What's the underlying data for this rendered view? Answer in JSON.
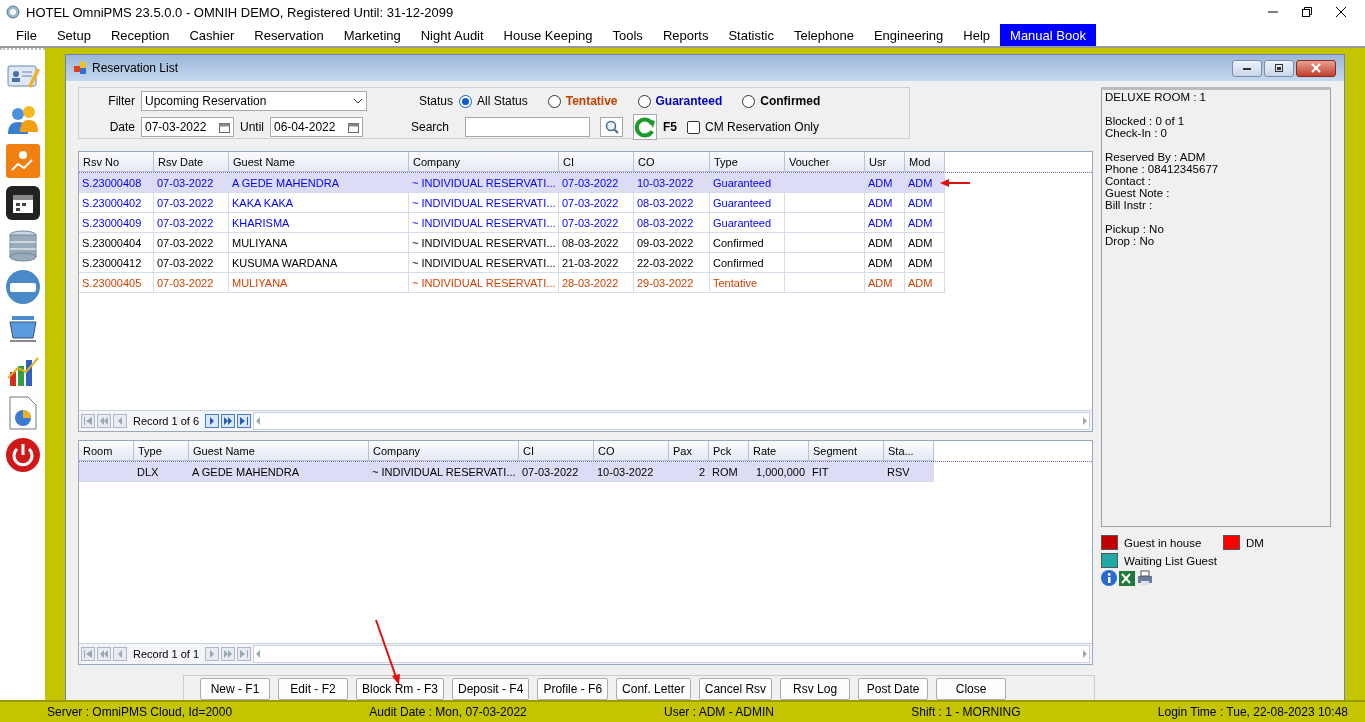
{
  "window": {
    "title": "HOTEL OmniPMS 23.5.0.0 - OMNIH DEMO, Registered Until: 31-12-2099"
  },
  "menu": [
    {
      "label": "File",
      "selected": false
    },
    {
      "label": "Setup",
      "selected": false
    },
    {
      "label": "Reception",
      "selected": false
    },
    {
      "label": "Cashier",
      "selected": false
    },
    {
      "label": "Reservation",
      "selected": false
    },
    {
      "label": "Marketing",
      "selected": false
    },
    {
      "label": "Night Audit",
      "selected": false
    },
    {
      "label": "House Keeping",
      "selected": false
    },
    {
      "label": "Tools",
      "selected": false
    },
    {
      "label": "Reports",
      "selected": false
    },
    {
      "label": "Statistic",
      "selected": false
    },
    {
      "label": "Telephone",
      "selected": false
    },
    {
      "label": "Engineering",
      "selected": false
    },
    {
      "label": "Help",
      "selected": false
    },
    {
      "label": "Manual Book",
      "selected": true
    }
  ],
  "child_window": {
    "title": "Reservation List"
  },
  "filter": {
    "label": "Filter",
    "value": "Upcoming Reservation"
  },
  "date": {
    "label": "Date",
    "value": "07-03-2022"
  },
  "until": {
    "label": "Until",
    "value": "06-04-2022"
  },
  "status": {
    "label": "Status",
    "options": [
      {
        "label": "All Status",
        "kind": "plain",
        "selected": true,
        "color": "#000000"
      },
      {
        "label": "Tentative",
        "kind": "status",
        "selected": false,
        "color": "#c04000"
      },
      {
        "label": "Guaranteed",
        "kind": "status",
        "selected": false,
        "color": "#0000c0"
      },
      {
        "label": "Confirmed",
        "kind": "status",
        "selected": false,
        "color": "#000000"
      }
    ]
  },
  "search": {
    "label": "Search"
  },
  "refresh": {
    "label": "F5"
  },
  "cm_only": {
    "label": "CM Reservation Only",
    "checked": false
  },
  "reservations": {
    "columns": [
      "Rsv No",
      "Rsv Date",
      "Guest Name",
      "Company",
      "CI",
      "CO",
      "Type",
      "Voucher",
      "Usr",
      "Mod"
    ],
    "rows": [
      {
        "cells": [
          "S.23000408",
          "07-03-2022",
          "A GEDE MAHENDRA",
          "~ INDIVIDUAL RESERVATI...",
          "07-03-2022",
          "10-03-2022",
          "Guaranteed",
          null,
          "ADM",
          "ADM"
        ],
        "color": "#0000ff",
        "selected": true
      },
      {
        "cells": [
          "S.23000402",
          "07-03-2022",
          "KAKA KAKA",
          "~ INDIVIDUAL RESERVATI...",
          "07-03-2022",
          "08-03-2022",
          "Guaranteed",
          null,
          "ADM",
          "ADM"
        ],
        "color": "#0000ff",
        "selected": false
      },
      {
        "cells": [
          "S.23000409",
          "07-03-2022",
          "KHARISMA",
          "~ INDIVIDUAL RESERVATI...",
          "07-03-2022",
          "08-03-2022",
          "Guaranteed",
          null,
          "ADM",
          "ADM"
        ],
        "color": "#0000ff",
        "selected": false
      },
      {
        "cells": [
          "S.23000404",
          "07-03-2022",
          "MULIYANA",
          "~ INDIVIDUAL RESERVATI...",
          "08-03-2022",
          "09-03-2022",
          "Confirmed",
          null,
          "ADM",
          "ADM"
        ],
        "color": "#000000",
        "selected": false
      },
      {
        "cells": [
          "S.23000412",
          "07-03-2022",
          "KUSUMA WARDANA",
          "~ INDIVIDUAL RESERVATI...",
          "21-03-2022",
          "22-03-2022",
          "Confirmed",
          null,
          "ADM",
          "ADM"
        ],
        "color": "#000000",
        "selected": false
      },
      {
        "cells": [
          "S.23000405",
          "07-03-2022",
          "MULIYANA",
          "~ INDIVIDUAL RESERVATI...",
          "28-03-2022",
          "29-03-2022",
          "Tentative",
          null,
          "ADM",
          "ADM"
        ],
        "color": "#d04000",
        "selected": false
      }
    ],
    "pager": "Record 1 of 6"
  },
  "rooms": {
    "columns": [
      "Room",
      "Type",
      "Guest Name",
      "Company",
      "CI",
      "CO",
      "Pax",
      "Pck",
      "Rate",
      "Segment",
      "Sta..."
    ],
    "rows": [
      {
        "cells": [
          null,
          "DLX",
          "A GEDE MAHENDRA",
          "~ INDIVIDUAL RESERVATI...",
          "07-03-2022",
          "10-03-2022",
          "2",
          "ROM",
          "1,000,000",
          "FIT",
          "RSV"
        ],
        "selected": true
      }
    ],
    "pager": "Record 1 of 1"
  },
  "details": [
    [
      "DELUXE ROOM : 1"
    ],
    [
      "Blocked : 0 of 1",
      "Check-In : 0"
    ],
    [
      "Reserved By : ADM",
      "Phone : 08412345677",
      "Contact :",
      "Guest Note :",
      "Bill Instr :"
    ],
    [
      "Pickup : No",
      "Drop : No"
    ]
  ],
  "legend": [
    {
      "label": "Guest in house",
      "color": "#c00000"
    },
    {
      "label": "DM",
      "color": "#ff0000"
    },
    {
      "label": "Waiting List Guest",
      "color": "#20a8a8"
    }
  ],
  "buttons": [
    "New - F1",
    "Edit - F2",
    "Block Rm - F3",
    "Deposit - F4",
    "Profile  - F6",
    "Conf. Letter",
    "Cancel Rsv",
    "Rsv Log",
    "Post Date",
    "Close"
  ],
  "status_bar": [
    "Server : OmniPMS Cloud, Id=2000",
    "Audit Date : Mon, 07-03-2022",
    "User : ADM - ADMIN",
    "Shift : 1 - MORNING",
    "Login Time : Tue, 22-08-2023 10:48"
  ]
}
